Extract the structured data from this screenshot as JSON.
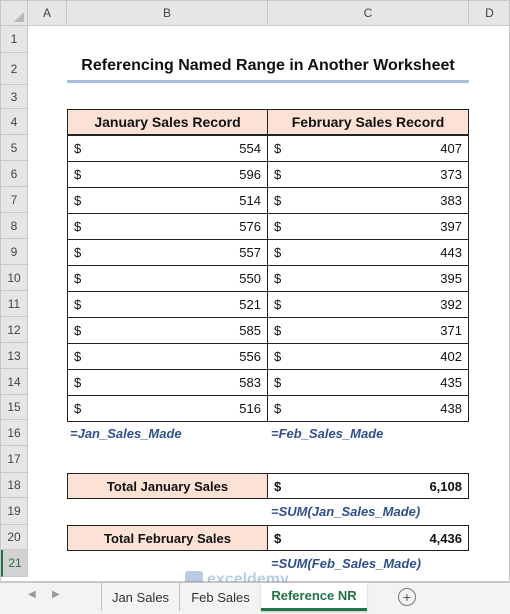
{
  "columns": [
    "A",
    "B",
    "C",
    "D"
  ],
  "rows": [
    "1",
    "2",
    "3",
    "4",
    "5",
    "6",
    "7",
    "8",
    "9",
    "10",
    "11",
    "12",
    "13",
    "14",
    "15",
    "16",
    "17",
    "18",
    "19",
    "20",
    "21"
  ],
  "title": "Referencing Named Range in Another Worksheet",
  "currency": "$",
  "headers": {
    "jan": "January Sales Record",
    "feb": "February Sales Record"
  },
  "jan_values": [
    "554",
    "596",
    "514",
    "576",
    "557",
    "550",
    "521",
    "585",
    "556",
    "583",
    "516"
  ],
  "feb_values": [
    "407",
    "373",
    "383",
    "397",
    "443",
    "395",
    "392",
    "371",
    "402",
    "435",
    "438"
  ],
  "formula_jan_name": "=Jan_Sales_Made",
  "formula_feb_name": "=Feb_Sales_Made",
  "totals": {
    "jan_label": "Total January Sales",
    "jan_value": "6,108",
    "jan_formula": "=SUM(Jan_Sales_Made)",
    "feb_label": "Total February Sales",
    "feb_value": "4,436",
    "feb_formula": "=SUM(Feb_Sales_Made)"
  },
  "tabs": [
    "Jan Sales",
    "Feb Sales",
    "Reference NR"
  ],
  "active_tab": "Reference NR",
  "selected_row": "21",
  "watermark": "exceldemy",
  "colors": {
    "header_fill": "#fbe2d5",
    "formula_text": "#2f4f8f",
    "accent": "#217346",
    "title_underline": "#a9bde0"
  },
  "icons": {
    "tab_prev": "triangle-left-icon",
    "tab_next": "triangle-right-icon",
    "add_sheet": "plus-circle-icon"
  }
}
